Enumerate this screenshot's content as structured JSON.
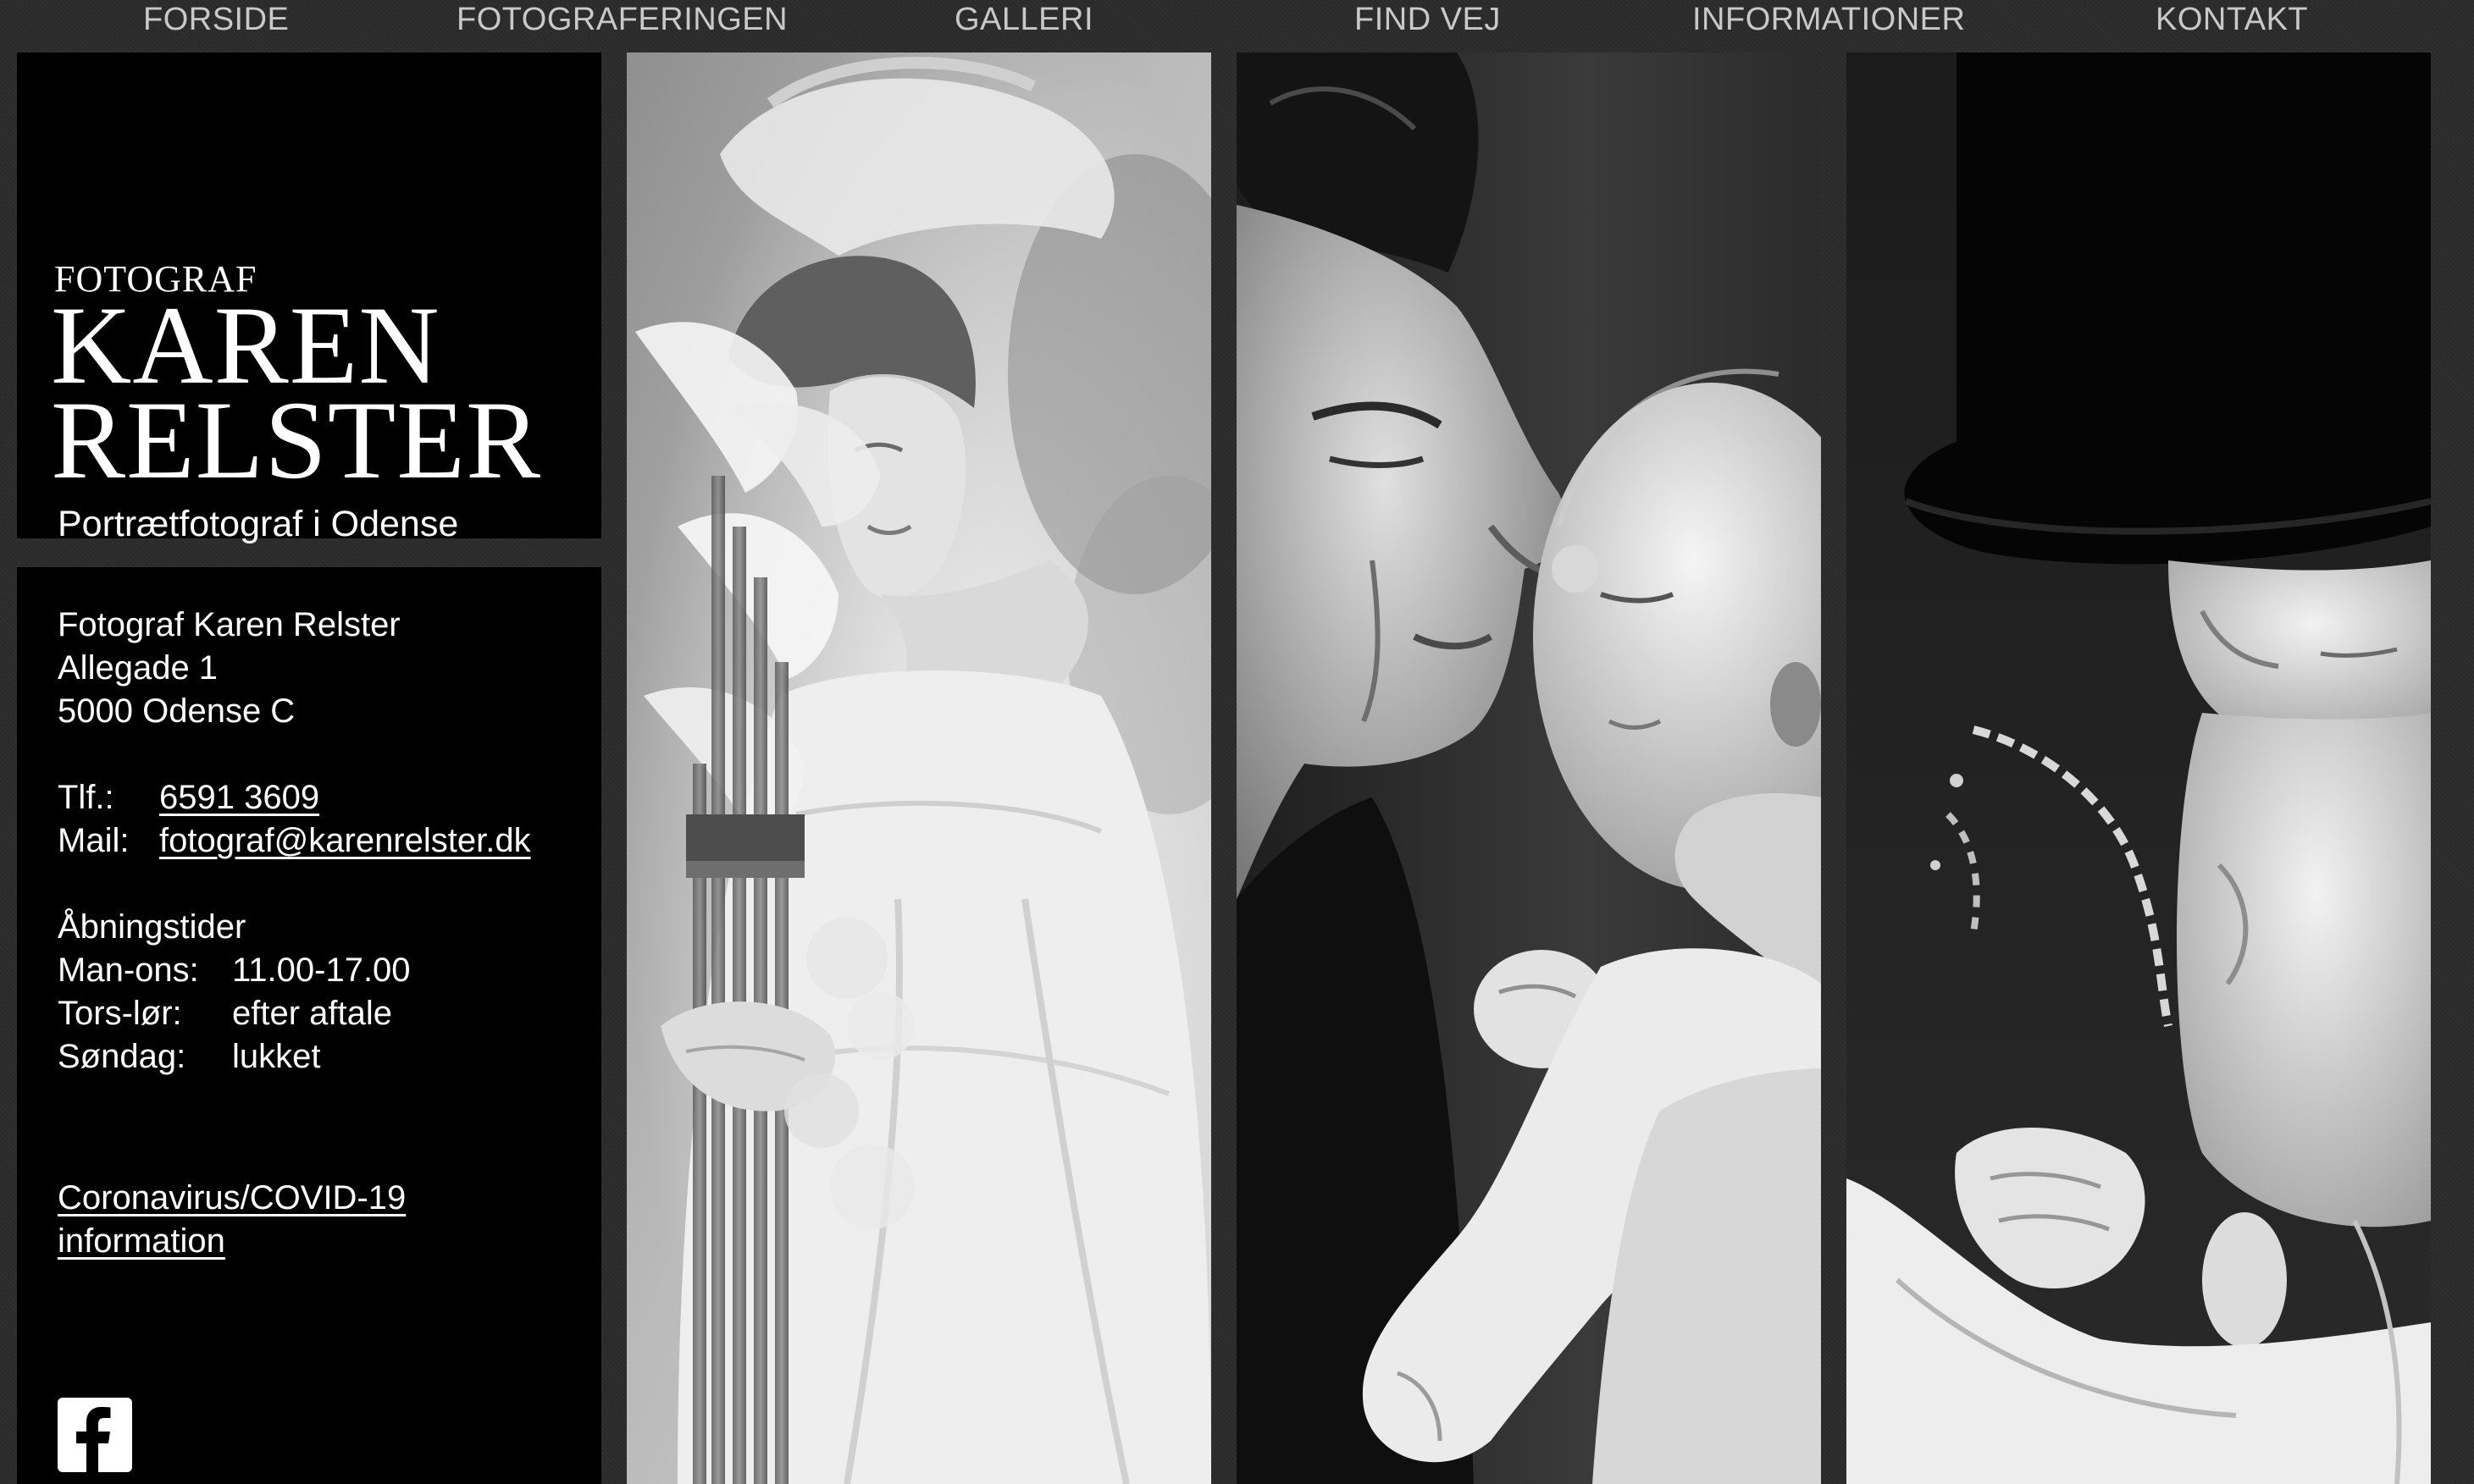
{
  "nav": {
    "items": [
      {
        "label": "FORSIDE"
      },
      {
        "label": "FOTOGRAFERINGEN"
      },
      {
        "label": "GALLERI"
      },
      {
        "label": "FIND VEJ"
      },
      {
        "label": "INFORMATIONER"
      },
      {
        "label": "KONTAKT"
      }
    ]
  },
  "logo": {
    "small": "FOTOGRAF",
    "line1": "KAREN",
    "line2": "RELSTER",
    "tagline": "Portrætfotograf i Odense"
  },
  "contact": {
    "name": "Fotograf Karen Relster",
    "street": "Allegade 1",
    "city": "5000 Odense C",
    "phone_label": "Tlf.:",
    "phone": "6591 3609",
    "mail_label": "Mail:",
    "mail": "fotograf@karenrelster.dk"
  },
  "hours": {
    "title": "Åbningstider",
    "rows": [
      {
        "day": "Man-ons:",
        "time": "11.00-17.00"
      },
      {
        "day": "Tors-lør:",
        "time": "efter aftale"
      },
      {
        "day": "Søndag:",
        "time": "lukket"
      }
    ]
  },
  "covid": {
    "line1": "Coronavirus/COVID-19",
    "line2": "information"
  },
  "social": {
    "icon": "facebook-icon"
  },
  "photos": [
    {
      "subject": "bride-with-calla-lilies"
    },
    {
      "subject": "father-kissing-baby"
    },
    {
      "subject": "baby-with-black-hat"
    }
  ]
}
